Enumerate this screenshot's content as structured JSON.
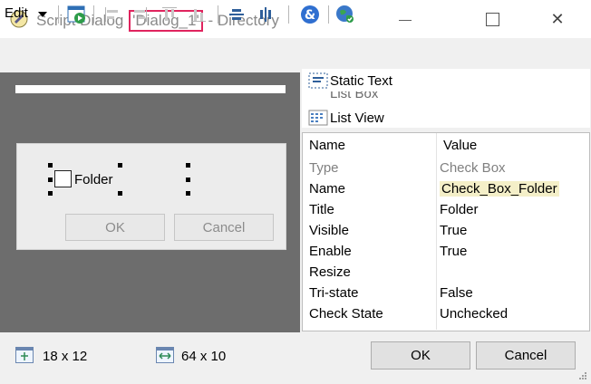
{
  "window": {
    "title_prefix": "Script Dialog ",
    "title_highlight": "'Dialog_1'",
    "title_suffix": " - Directory",
    "minimize_glyph": "—",
    "maximize_glyph": "☐",
    "close_glyph": "✕"
  },
  "toolbar": {
    "edit_label": "Edit",
    "icons": [
      "run-dialog-icon",
      "align-left-icon",
      "align-right-icon",
      "align-top-icon",
      "align-bottom-icon",
      "center-vertical-icon",
      "center-horizontal-icon",
      "tab-order-icon",
      "globe-icon"
    ]
  },
  "canvas": {
    "checkbox_label": "Folder",
    "ok_label": "OK",
    "cancel_label": "Cancel"
  },
  "controls": {
    "items": [
      "Static Text",
      "List Box",
      "List View"
    ]
  },
  "properties": {
    "header_name": "Name",
    "header_value": "Value",
    "rows": [
      {
        "name": "Type",
        "value": "Check Box"
      },
      {
        "name": "Name",
        "value": "Check_Box_Folder"
      },
      {
        "name": "Title",
        "value": "Folder"
      },
      {
        "name": "Visible",
        "value": "True"
      },
      {
        "name": "Enable",
        "value": "True"
      },
      {
        "name": "Resize",
        "value": ""
      },
      {
        "name": "Tri-state",
        "value": "False"
      },
      {
        "name": "Check State",
        "value": "Unchecked"
      }
    ]
  },
  "footer": {
    "position": "18 x 12",
    "size": "64 x 10",
    "ok_label": "OK",
    "cancel_label": "Cancel"
  }
}
